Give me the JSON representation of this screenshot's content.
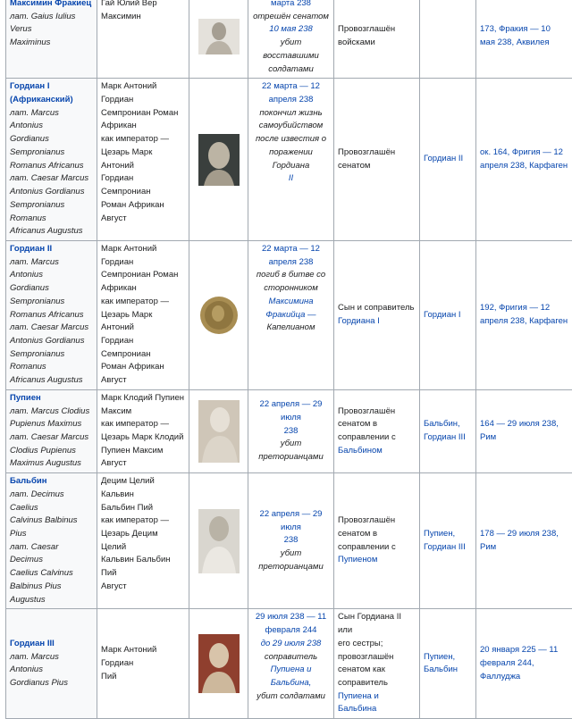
{
  "rows": [
    {
      "name": "Максимин Фракиец",
      "lat": [
        "лат. Gaius Iulius Verus",
        "Maximinus"
      ],
      "full": [
        "Гай Юлий Вер",
        "Максимин"
      ],
      "reign_dates": [
        "марта 238"
      ],
      "reign_event": [
        "отрешён сенатом",
        "10 мая 238",
        "убит восставшими",
        "солдатами"
      ],
      "acc": [
        "Провозглашён",
        "войсками"
      ],
      "rel": [],
      "life": [
        "173, Фракия — 10",
        "мая 238, Аквилея"
      ]
    },
    {
      "name": "Гордиан I (Африканский)",
      "lat": [
        "лат. Marcus Antonius",
        "Gordianus Sempronianus",
        "Romanus Africanus",
        "лат. Caesar Marcus",
        "Antonius Gordianus",
        "Sempronianus Romanus",
        "Africanus Augustus"
      ],
      "full": [
        "Марк Антоний Гордиан",
        "Семпрониан Роман",
        "Африкан",
        "как император —",
        "Цезарь Марк Антоний",
        "Гордиан Семпрониан",
        "Роман Африкан Август"
      ],
      "reign_dates": [
        "22 марта — 12",
        "апреля 238"
      ],
      "reign_event": [
        "покончил жизнь",
        "самоубийством",
        "после известия о",
        "поражении Гордиана",
        "II"
      ],
      "acc": [
        "Провозглашён",
        "сенатом"
      ],
      "rel": [
        "Гордиан II"
      ],
      "life": [
        "ок. 164, Фригия — 12",
        "апреля 238, Карфаген"
      ]
    },
    {
      "name": "Гордиан II",
      "lat": [
        "лат. Marcus Antonius",
        "Gordianus Sempronianus",
        "Romanus Africanus",
        "лат. Caesar Marcus",
        "Antonius Gordianus",
        "Sempronianus Romanus",
        "Africanus Augustus"
      ],
      "full": [
        "Марк Антоний Гордиан",
        "Семпрониан Роман",
        "Африкан",
        "как император —",
        "Цезарь Марк Антоний",
        "Гордиан Семпрониан",
        "Роман Африкан Август"
      ],
      "reign_dates": [
        "22 марта — 12",
        "апреля 238"
      ],
      "reign_event": [
        "погиб в битве со",
        "сторонником",
        "Максимина",
        "Фракийца —",
        "Капелианом"
      ],
      "acc": [
        "Сын и соправитель",
        "Гордиана I"
      ],
      "rel": [
        "Гордиан I"
      ],
      "life": [
        "192, Фригия — 12",
        "апреля 238, Карфаген"
      ]
    },
    {
      "name": "Пупиен",
      "lat": [
        "лат. Marcus Clodius",
        "Pupienus Maximus",
        "лат. Caesar Marcus",
        "Clodius Pupienus",
        "Maximus Augustus"
      ],
      "full": [
        "Марк Клодий Пупиен",
        "Максим",
        "как император —",
        "Цезарь Марк Клодий",
        "Пупиен Максим Август"
      ],
      "reign_dates": [
        "22 апреля — 29 июля",
        "238"
      ],
      "reign_event": [
        "убит преторианцами"
      ],
      "acc": [
        "Провозглашён",
        "сенатом в",
        "соправлении с",
        "Бальбином"
      ],
      "rel": [
        "Бальбин,",
        "Гордиан III"
      ],
      "life": [
        "164 — 29 июля 238,",
        "Рим"
      ]
    },
    {
      "name": "Бальбин",
      "lat": [
        "лат. Decimus Caelius",
        "Calvinus Balbinus Pius",
        "лат. Caesar Decimus",
        "Caelius Calvinus",
        "Balbinus Pius Augustus"
      ],
      "full": [
        "Децим Целий Кальвин",
        "Бальбин Пий",
        "как император —",
        "Цезарь Децим Целий",
        "Кальвин Бальбин Пий",
        "Август"
      ],
      "reign_dates": [
        "22 апреля — 29 июля",
        "238"
      ],
      "reign_event": [
        "убит преторианцами"
      ],
      "acc": [
        "Провозглашён",
        "сенатом в",
        "соправлении с",
        "Пупиеном"
      ],
      "rel": [
        "Пупиен,",
        "Гордиан III"
      ],
      "life": [
        "178 — 29 июля 238,",
        "Рим"
      ]
    },
    {
      "name": "Гордиан III",
      "lat": [
        "лат. Marcus Antonius",
        "Gordianus Pius"
      ],
      "full": [
        "Марк Антоний Гордиан",
        "Пий"
      ],
      "reign_dates": [
        "29 июля 238 — 11",
        "февраля 244",
        "до 29 июля 238"
      ],
      "reign_event": [
        "соправитель",
        "Пупиена и Бальбина,",
        "убит солдатами"
      ],
      "acc": [
        "Сын Гордиана II или",
        "его сестры;",
        "провозглашён",
        "сенатом как",
        "соправитель",
        "Пупиена и Бальбина"
      ],
      "rel": [
        "Пупиен,",
        "Бальбин"
      ],
      "life": [
        "20 января 225 — 11",
        "февраля 244,",
        "Фаллуджа"
      ]
    }
  ]
}
